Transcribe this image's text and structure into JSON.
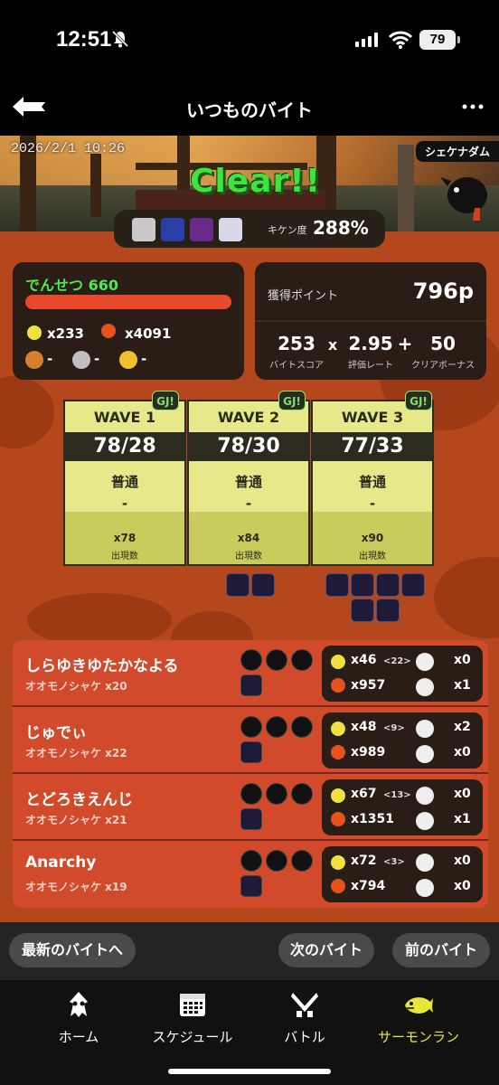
{
  "status_bar": {
    "time": "12:51",
    "battery": "79"
  },
  "header": {
    "title": "いつものバイト"
  },
  "banner": {
    "date": "2026/2/1 10:26",
    "stage": "シェケナダム",
    "result": "Clear!!"
  },
  "danger": {
    "label": "キケン度",
    "value": "288%"
  },
  "rank": {
    "title": "でんせつ 660",
    "golden_eggs": "x233",
    "power_eggs": "x4091",
    "egg1": "-",
    "egg2": "-",
    "egg3": "-"
  },
  "points": {
    "label": "獲得ポイント",
    "value": "796p",
    "score": "253",
    "score_label": "バイトスコア",
    "times": "x",
    "rate": "2.95",
    "rate_label": "評価レート",
    "plus": "+",
    "bonus": "50",
    "bonus_label": "クリアボーナス"
  },
  "waves": [
    {
      "title": "WAVE 1",
      "score": "78/28",
      "tide": "普通",
      "event": "-",
      "quota": "x78",
      "quota_label": "出現数",
      "badge": "GJ!"
    },
    {
      "title": "WAVE 2",
      "score": "78/30",
      "tide": "普通",
      "event": "-",
      "quota": "x84",
      "quota_label": "出現数",
      "badge": "GJ!"
    },
    {
      "title": "WAVE 3",
      "score": "77/33",
      "tide": "普通",
      "event": "-",
      "quota": "x90",
      "quota_label": "出現数",
      "badge": "GJ!"
    }
  ],
  "players": [
    {
      "name": "しらゆきゆたかなよる",
      "sub": "オオモノシャケ x20",
      "golden": "x46",
      "assist": "<22>",
      "rescue": "x0",
      "power": "x957",
      "rescued": "x1"
    },
    {
      "name": "じゅでぃ",
      "sub": "オオモノシャケ x22",
      "golden": "x48",
      "assist": "<9>",
      "rescue": "x2",
      "power": "x989",
      "rescued": "x0"
    },
    {
      "name": "とどろきえんじ",
      "sub": "オオモノシャケ x21",
      "golden": "x67",
      "assist": "<13>",
      "rescue": "x0",
      "power": "x1351",
      "rescued": "x1"
    },
    {
      "name": "Anarchy",
      "sub": "オオモノシャケ x19",
      "golden": "x72",
      "assist": "<3>",
      "rescue": "x0",
      "power": "x794",
      "rescued": "x0"
    }
  ],
  "buttons": {
    "latest": "最新のバイトへ",
    "next": "次のバイト",
    "prev": "前のバイト"
  },
  "tabs": [
    {
      "label": "ホーム",
      "icon": "squid-icon",
      "color": "#ffffff"
    },
    {
      "label": "スケジュール",
      "icon": "calendar-icon",
      "color": "#ffffff"
    },
    {
      "label": "バトル",
      "icon": "crossed-weapons-icon",
      "color": "#ffffff"
    },
    {
      "label": "サーモンラン",
      "icon": "salmon-icon",
      "color": "#e8e83a"
    }
  ],
  "colors": {
    "accent_green": "#3fe23f",
    "salmon_orange": "#b4471c",
    "active_tab": "#e8e83a"
  }
}
